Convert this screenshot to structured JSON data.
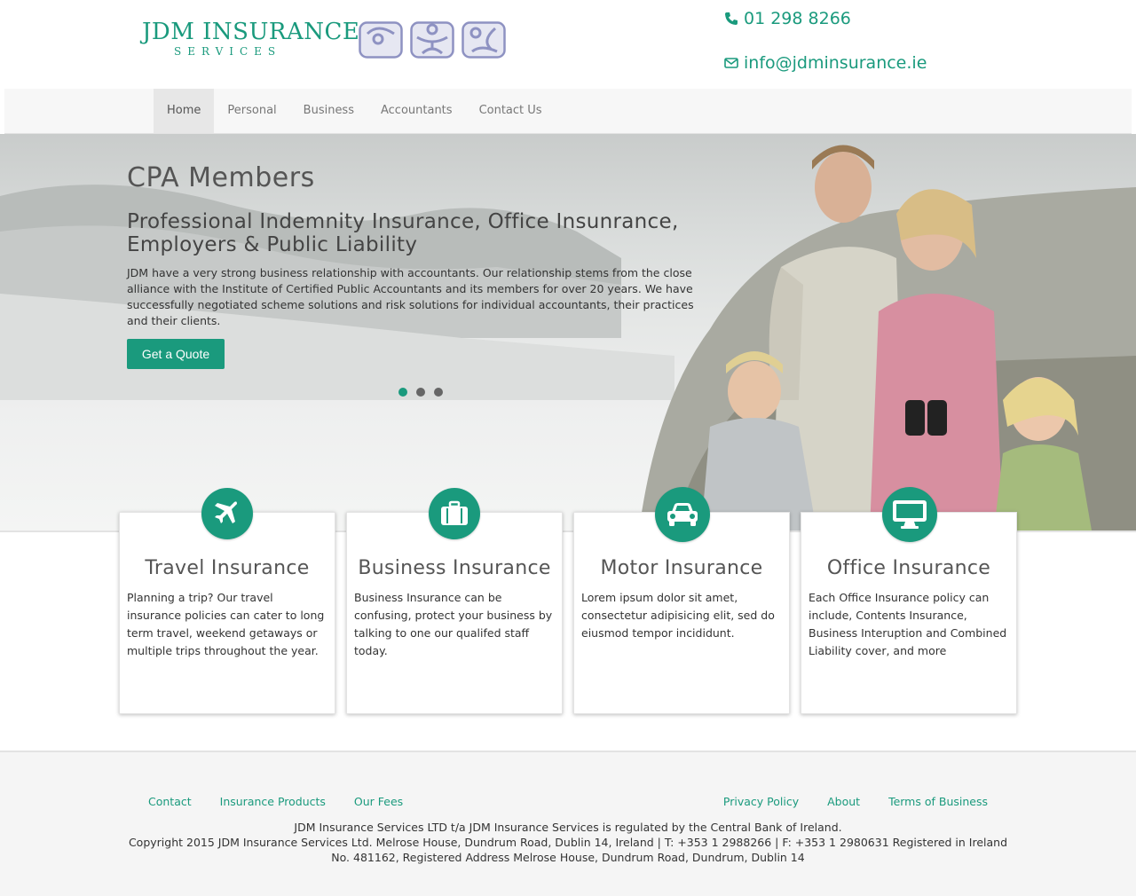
{
  "header": {
    "logo_main": "JDM INSURANCE",
    "logo_sub": "SERVICES",
    "phone": "01 298 8266",
    "email": "info@jdminsurance.ie"
  },
  "nav": {
    "items": [
      {
        "label": "Home",
        "active": true
      },
      {
        "label": "Personal"
      },
      {
        "label": "Business"
      },
      {
        "label": "Accountants"
      },
      {
        "label": "Contact Us"
      }
    ]
  },
  "hero": {
    "title": "CPA Members",
    "subtitle": "Professional Indemnity Insurance, Office Insunrance, Employers & Public Liability",
    "text": "JDM have a very strong business relationship with accountants. Our relationship stems from the close alliance with the Institute of Certified Public Accountants and its members for over 20 years. We have successfully negotiated scheme solutions and risk solutions for individual accountants, their practices and their clients.",
    "button_label": "Get a Quote",
    "slides_count": 3,
    "active_slide": 1
  },
  "services": [
    {
      "icon": "plane-icon",
      "title": "Travel Insurance",
      "text": "Planning a trip? Our travel insurance policies can cater to long term travel, weekend getaways or multiple trips throughout the year."
    },
    {
      "icon": "briefcase-icon",
      "title": "Business Insurance",
      "text": "Business Insurance can be confusing, protect your business by talking to one our qualifed staff today."
    },
    {
      "icon": "car-icon",
      "title": "Motor Insurance",
      "text": "Lorem ipsum dolor sit amet, consectetur adipisicing elit, sed do eiusmod tempor incididunt."
    },
    {
      "icon": "monitor-icon",
      "title": "Office Insurance",
      "text": "Each Office Insurance policy can include, Contents Insurance, Business Interuption and Combined Liability cover, and more"
    }
  ],
  "footer": {
    "links_left": [
      "Contact",
      "Insurance Products",
      "Our Fees"
    ],
    "links_right": [
      "Privacy Policy",
      "About",
      "Terms of Business"
    ],
    "legal_line1": "JDM Insurance Services LTD t/a JDM Insurance Services is regulated by the Central Bank of Ireland.",
    "legal_line2": "Copyright 2015 JDM Insurance Services Ltd. Melrose House, Dundrum Road, Dublin 14, Ireland | T: +353 1 2988266 | F: +353 1 2980631 Registered in Ireland No. 481162, Registered Address Melrose House, Dundrum Road, Dundrum, Dublin 14"
  },
  "colors": {
    "accent": "#1a9a7d",
    "nav_bg": "#f7f7f7",
    "footer_bg": "#f5f5f5",
    "logo_figure": "#8e92c2"
  }
}
